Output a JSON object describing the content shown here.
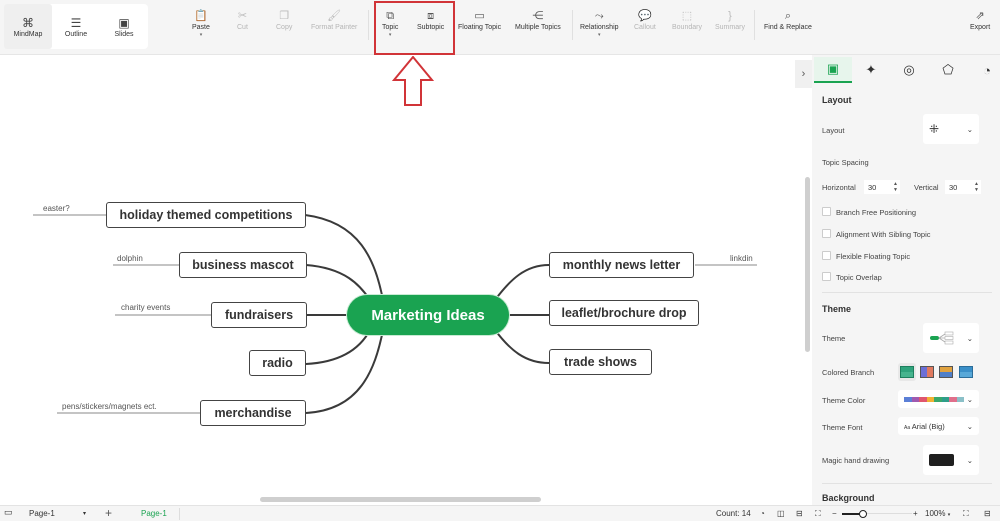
{
  "toolbar": {
    "views": [
      {
        "label": "MindMap",
        "icon": "mindmap-icon",
        "glyph": "⌘",
        "active": true
      },
      {
        "label": "Outline",
        "icon": "outline-icon",
        "glyph": "☰",
        "active": false
      },
      {
        "label": "Slides",
        "icon": "slides-icon",
        "glyph": "▣",
        "active": false
      }
    ],
    "buttons": {
      "paste": {
        "label": "Paste",
        "glyph": "📋"
      },
      "cut": {
        "label": "Cut",
        "glyph": "✂"
      },
      "copy": {
        "label": "Copy",
        "glyph": "❐"
      },
      "format_painter": {
        "label": "Format Painter",
        "glyph": "🖌"
      },
      "topic": {
        "label": "Topic",
        "glyph": "⧉"
      },
      "subtopic": {
        "label": "Subtopic",
        "glyph": "⧈"
      },
      "floating_topic": {
        "label": "Floating Topic",
        "glyph": "▭"
      },
      "multiple_topics": {
        "label": "Multiple Topics",
        "glyph": "⋲"
      },
      "relationship": {
        "label": "Relationship",
        "glyph": "⤳"
      },
      "callout": {
        "label": "Callout",
        "glyph": "💬"
      },
      "boundary": {
        "label": "Boundary",
        "glyph": "⬚"
      },
      "summary": {
        "label": "Summary",
        "glyph": "}"
      },
      "find_replace": {
        "label": "Find & Replace",
        "glyph": "⌕"
      },
      "export": {
        "label": "Export",
        "glyph": "⇗"
      }
    },
    "caret": "▾"
  },
  "mindmap": {
    "root": "Marketing Ideas",
    "left_topics": [
      {
        "label": "holiday themed competitions",
        "note": "easter?"
      },
      {
        "label": "business mascot",
        "note": "dolphin"
      },
      {
        "label": "fundraisers",
        "note": "charity events"
      },
      {
        "label": "radio",
        "note": ""
      },
      {
        "label": "merchandise",
        "note": "pens/stickers/magnets ect."
      }
    ],
    "right_topics": [
      {
        "label": "monthly news letter",
        "note": "linkdin"
      },
      {
        "label": "leaflet/brochure drop",
        "note": ""
      },
      {
        "label": "trade shows",
        "note": ""
      }
    ]
  },
  "panel": {
    "collapse_glyph": "›",
    "tabs": [
      {
        "name": "layout-tab",
        "glyph": "▣",
        "active": true
      },
      {
        "name": "ai-tab",
        "glyph": "✦",
        "active": false
      },
      {
        "name": "marker-tab",
        "glyph": "◎",
        "active": false
      },
      {
        "name": "style-tab",
        "glyph": "⬠",
        "active": false
      },
      {
        "name": "history-tab",
        "glyph": "◔",
        "active": false
      }
    ],
    "layout_section": "Layout",
    "layout_label": "Layout",
    "layout_glyph": "⁜",
    "topic_spacing": "Topic Spacing",
    "horizontal_label": "Horizontal",
    "horizontal_value": "30",
    "vertical_label": "Vertical",
    "vertical_value": "30",
    "checkboxes": [
      {
        "label": "Branch Free Positioning",
        "checked": false
      },
      {
        "label": "Alignment With Sibling Topic",
        "checked": false
      },
      {
        "label": "Flexible Floating Topic",
        "checked": false
      },
      {
        "label": "Topic Overlap",
        "checked": false
      }
    ],
    "theme_section": "Theme",
    "theme_label": "Theme",
    "colored_branch_label": "Colored Branch",
    "theme_color_label": "Theme Color",
    "theme_colors": [
      "#5b7fd6",
      "#a05ab0",
      "#e0566e",
      "#f2b233",
      "#3aa86b",
      "#2f9e8a",
      "#e06f8b",
      "#8bc0c8"
    ],
    "theme_font_label": "Theme Font",
    "theme_font_value": "Arial (Big)",
    "theme_font_prefix": "Aa",
    "magic_label": "Magic hand drawing",
    "magic_color": "#1f1f1f",
    "background_section": "Background",
    "dropdown_glyph": "⌄"
  },
  "statusbar": {
    "page_select": "Page-1",
    "add_page": "+",
    "active_page": "Page-1",
    "count": "Count: 14",
    "zoom": "100%",
    "zoom_minus": "−",
    "zoom_plus": "+",
    "zoom_fraction": 0.3
  },
  "colors": {
    "accent": "#1aa351",
    "highlight": "#d13438"
  }
}
